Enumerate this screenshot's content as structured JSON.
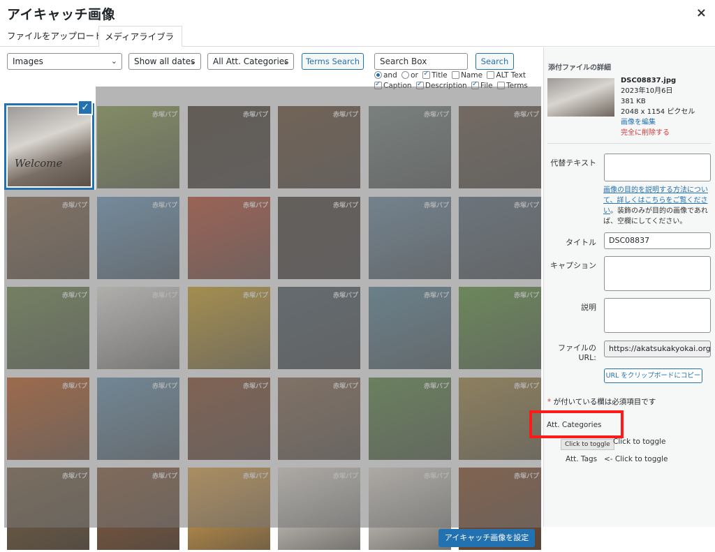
{
  "modal": {
    "title": "アイキャッチ画像",
    "close": "×"
  },
  "tabs": [
    {
      "label": "ファイルをアップロード"
    },
    {
      "label": "メディアライブラリ"
    }
  ],
  "filters": {
    "type": "Images",
    "dates": "Show all dates",
    "categories": "All Att. Categories",
    "terms_search": "Terms Search",
    "search_placeholder": "Search Box",
    "search_button": "Search"
  },
  "search_options": {
    "and": "and",
    "or": "or",
    "title": "Title",
    "name": "Name",
    "alt": "ALT Text",
    "caption": "Caption",
    "description": "Description",
    "file": "File",
    "terms": "Terms"
  },
  "grid": {
    "watermark": "赤塚バプ",
    "selected_word": "Welcome",
    "thumb_colors": [
      [
        "#8fa34f",
        "#4a3b2e",
        "#6a4a30",
        "#7a8a85",
        "#6d5a48"
      ],
      [
        "#8d6a48",
        "#6fa0c8",
        "#c44a2e",
        "#4a4038",
        "#6d8fa8",
        "#5d7080"
      ],
      [
        "#6f8a48",
        "#f3f0ea",
        "#d8a820",
        "#4d5c66",
        "#5a8aa0",
        "#5e9a3a"
      ],
      [
        "#c85a18",
        "#6a98b8",
        "#8a4a2a",
        "#8a6a50",
        "#5a8a40",
        "#a88a40"
      ],
      [
        "#7a6040",
        "#8a5a38",
        "#e8a848",
        "#ede6dc",
        "#ede6dc",
        "#8a4a20"
      ]
    ]
  },
  "details": {
    "heading": "添付ファイルの詳細",
    "filename": "DSC08837.jpg",
    "date": "2023年10月6日",
    "size": "381 KB",
    "dimensions": "2048 x 1154 ピクセル",
    "edit_link": "画像を編集",
    "delete_link": "完全に削除する",
    "alt_label": "代替テキスト",
    "alt_value": "",
    "help_link": "画像の目的を説明する方法について、詳しくはこちらをご覧ください",
    "help_text": "。装飾のみが目的の画像であれば、空欄にしてください。",
    "title_label": "タイトル",
    "title_value": "DSC08837",
    "caption_label": "キャプション",
    "caption_value": "",
    "desc_label": "説明",
    "desc_value": "",
    "url_label": "ファイルの URL:",
    "url_value": "https://akatsukakyokai.org/w",
    "copy_button": "URL をクリップボードにコピー",
    "required_star": "*",
    "required_note": "が付いている欄は必須項目です",
    "att_categories": "Att. Categories",
    "tooltip": "Click to toggle",
    "cat_toggle": "Click to toggle",
    "att_tags": "Att. Tags",
    "tags_toggle": "<- Click to toggle"
  },
  "footer": {
    "set_button": "アイキャッチ画像を設定"
  }
}
